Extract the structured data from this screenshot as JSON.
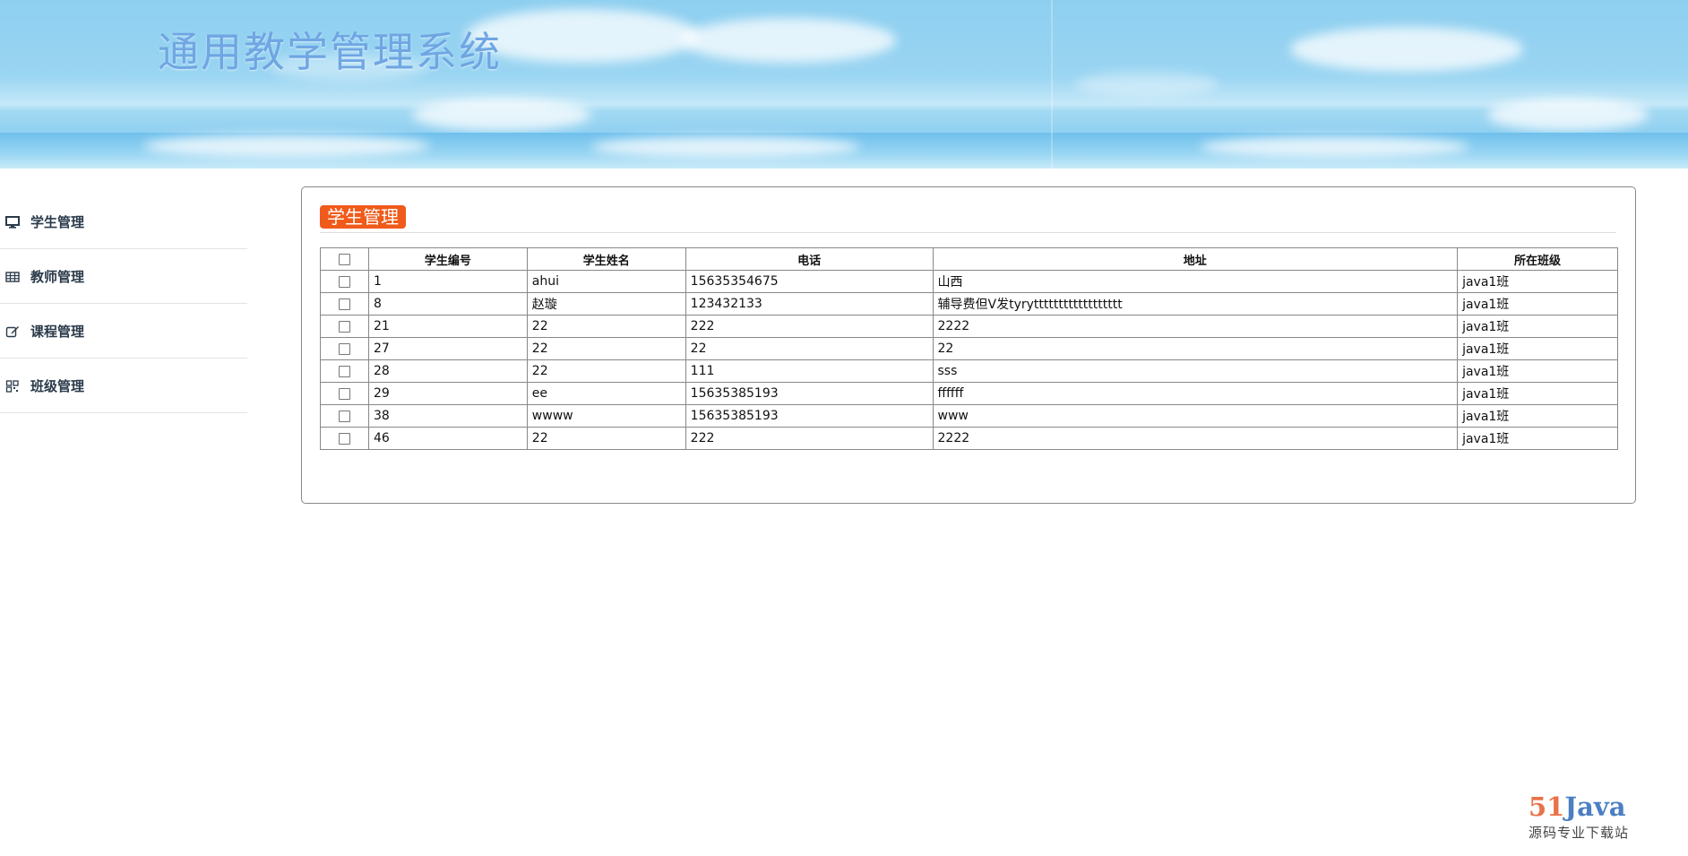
{
  "header": {
    "title": "通用教学管理系统"
  },
  "sidebar": {
    "items": [
      {
        "label": "学生管理",
        "icon": "monitor-icon"
      },
      {
        "label": "教师管理",
        "icon": "table-icon"
      },
      {
        "label": "课程管理",
        "icon": "edit-icon"
      },
      {
        "label": "班级管理",
        "icon": "grid-icon"
      }
    ]
  },
  "panel": {
    "title": "学生管理",
    "accent_color": "#f05a1a"
  },
  "table": {
    "headers": [
      "学生编号",
      "学生姓名",
      "电话",
      "地址",
      "所在班级"
    ],
    "rows": [
      [
        "1",
        "ahui",
        "15635354675",
        "山西",
        "java1班"
      ],
      [
        "8",
        "赵璇",
        "123432133",
        "辅导费但V发tyrytttttttttttttttttt",
        "java1班"
      ],
      [
        "21",
        "22",
        "222",
        "2222",
        "java1班"
      ],
      [
        "27",
        "22",
        "22",
        "22",
        "java1班"
      ],
      [
        "28",
        "22",
        "111",
        "sss",
        "java1班"
      ],
      [
        "29",
        "ee",
        "15635385193",
        "ffffff",
        "java1班"
      ],
      [
        "38",
        "wwww",
        "15635385193",
        "www",
        "java1班"
      ],
      [
        "46",
        "22",
        "222",
        "2222",
        "java1班"
      ]
    ]
  },
  "watermark": {
    "logo_num": "51",
    "logo_text": "Java",
    "subtitle": "源码专业下载站"
  }
}
